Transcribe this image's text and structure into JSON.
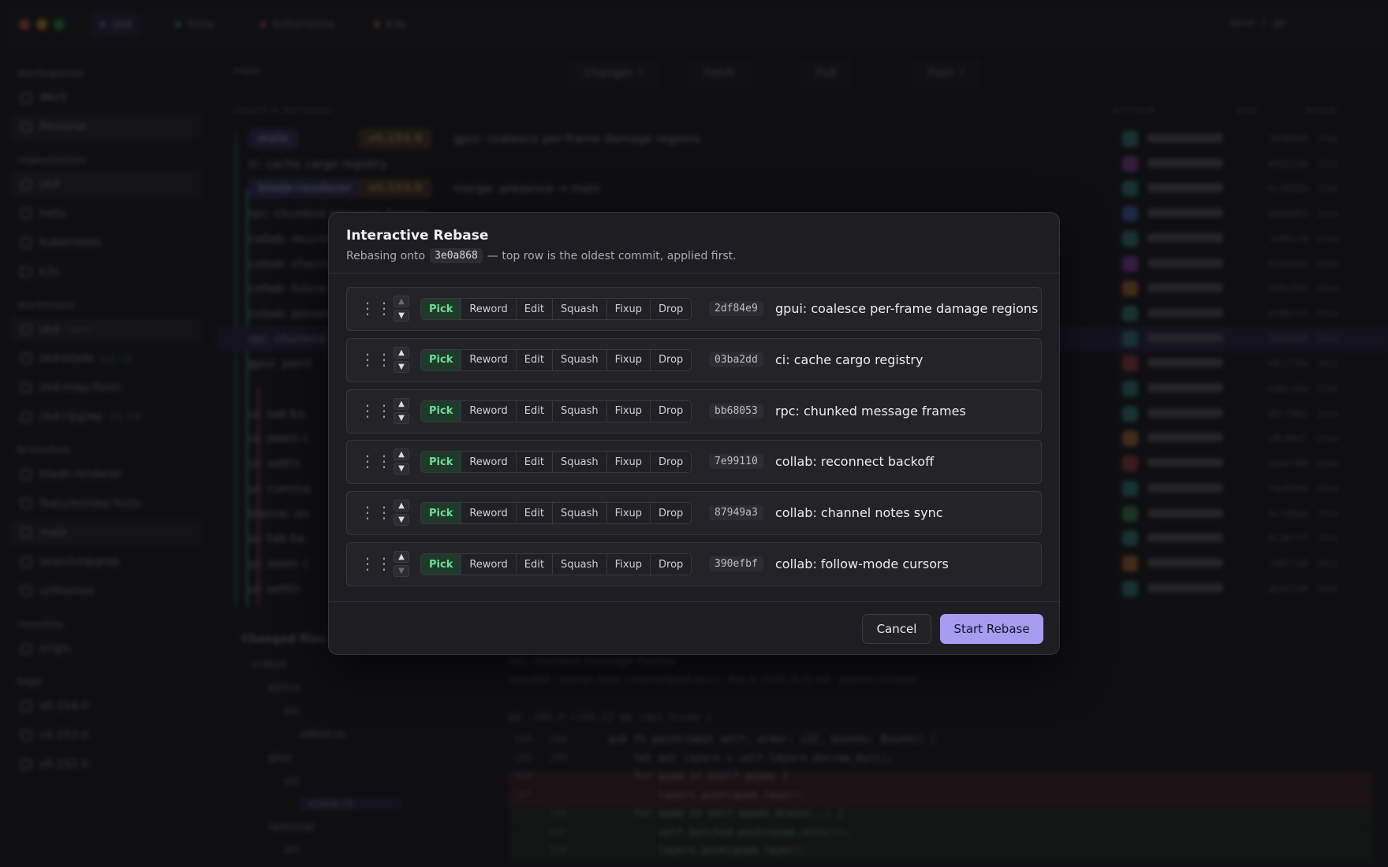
{
  "window": {
    "tabs": [
      {
        "label": "zed",
        "color": "#8b7cff"
      },
      {
        "label": "helix",
        "color": "#4cc47a"
      },
      {
        "label": "kubernetes",
        "color": "#e05a7a"
      },
      {
        "label": "k3s",
        "color": "#e0a040"
      }
    ],
    "branch_path": "main / go"
  },
  "sidebar": {
    "workspaces_heading": "workspaces",
    "workspaces": [
      "Work",
      "Personal"
    ],
    "repositories_heading": "repositories",
    "repositories": [
      "zed",
      "helix",
      "kubernetes",
      "k3s"
    ],
    "worktrees_heading": "worktrees",
    "worktrees": [
      {
        "label": "zed",
        "note": "(user)"
      },
      {
        "label": "zed-blade",
        "note": "+1 −2"
      },
      {
        "label": "zed-inlay-fonts",
        "note": ""
      },
      {
        "label": "zed-ripgrep",
        "note": "+1 ↑3"
      }
    ],
    "branches_heading": "branches",
    "branches": [
      "blade-renderer",
      "feature/inlay-fonts",
      "main",
      "search/ripgrep",
      "ui/themes"
    ],
    "remotes_heading": "remotes",
    "remotes": [
      "origin"
    ],
    "tags_heading": "tags",
    "tags": [
      "v0.154.0",
      "v0.153.0",
      "v0.152.0"
    ]
  },
  "main": {
    "breadcrumb": "main",
    "toolbar": {
      "changes": "Changes",
      "changes_count": "7",
      "fetch": "Fetch",
      "pull": "Pull",
      "push": "Push",
      "push_count": "7"
    },
    "columns": {
      "graph": "GRAPH & MESSAGE",
      "author": "AUTHOR",
      "sha": "SHA",
      "when": "WHEN"
    },
    "commits": [
      {
        "msg": "gpui: coalesce per-frame damage regions",
        "sha": "2df84e9",
        "when": "2mo",
        "avatar": "#3aa6a0",
        "pills": [
          "main",
          "v0.154.0"
        ]
      },
      {
        "msg": "ci: cache cargo registry",
        "sha": "03ba2dd",
        "when": "2mo",
        "avatar": "#b04ad0",
        "pills": []
      },
      {
        "msg": "merge: presence → main",
        "sha": "bc59d8a",
        "when": "2mo",
        "avatar": "#3aa6a0",
        "pills": [
          "blade-renderer",
          "v0.153.0"
        ]
      },
      {
        "msg": "rpc: chunked message frames",
        "sha": "bb68053",
        "when": "2mo",
        "avatar": "#4a7ae0",
        "pills": []
      },
      {
        "msg": "collab: reconnect backoff",
        "sha": "7e99110",
        "when": "2mo",
        "avatar": "#3aa6a0",
        "pills": []
      },
      {
        "msg": "collab: channel notes sync",
        "sha": "87949a3",
        "when": "2mo",
        "avatar": "#b04ad0",
        "pills": []
      },
      {
        "msg": "collab: follow-mode cursors",
        "sha": "390efbf",
        "when": "2mo",
        "avatar": "#e08a3a",
        "pills": []
      },
      {
        "msg": "collab: presence",
        "sha": "a3957f1",
        "when": "2mo",
        "avatar": "#3aa6a0",
        "pills": []
      },
      {
        "msg": "rpc: chunked",
        "sha": "3e0a868",
        "when": "2mo",
        "avatar": "#3aa6a0",
        "pills": []
      },
      {
        "msg": "gpui: point",
        "sha": "b812f5e",
        "when": "2mo",
        "avatar": "#d04848",
        "pills": []
      },
      {
        "msg": "",
        "sha": "eddc20a",
        "when": "2mo",
        "avatar": "#3aa6a0",
        "pills": []
      },
      {
        "msg": "ui: tab ba",
        "sha": "82cf962",
        "when": "2mo",
        "avatar": "#3aa6a0",
        "pills": []
      },
      {
        "msg": "ui: zoom c",
        "sha": "c8c86ef",
        "when": "2mo",
        "avatar": "#e08a3a",
        "pills": []
      },
      {
        "msg": "ui: settin",
        "sha": "1e4678d",
        "when": "2mo",
        "avatar": "#d04848",
        "pills": []
      },
      {
        "msg": "ui: comma",
        "sha": "7ac00ed",
        "when": "2mo",
        "avatar": "#3aa6a0",
        "pills": []
      },
      {
        "msg": "theme: on",
        "sha": "4c7d5ae",
        "when": "2mo",
        "avatar": "#4cb050",
        "pills": []
      },
      {
        "msg": "ui: tab ba",
        "sha": "4c3677f",
        "when": "2mo",
        "avatar": "#3aa6a0",
        "pills": []
      },
      {
        "msg": "ui: zoom c",
        "sha": "c4877a0",
        "when": "2mo",
        "avatar": "#e08a3a",
        "pills": []
      },
      {
        "msg": "ui: settin",
        "sha": "ab14fe8",
        "when": "2mo",
        "avatar": "#3aa6a0",
        "pills": []
      }
    ]
  },
  "bottom": {
    "changed_files": "Changed files",
    "tree": [
      "crates",
      "editor",
      "src",
      "editor.rs",
      "gpui",
      "src",
      "scene.rs",
      "terminal",
      "src"
    ],
    "commit_title": "rpc: chunked message frames",
    "commit_meta": "3e0a868 · Nathan Sobo <nathan@zed.dev> · Mar 9, 2026, 8:32 AM · parents a7b4aaf",
    "hunk": "@@ -184,9 +184,12 @@ impl Scene {",
    "diff": [
      {
        "kind": "ctx",
        "old": "184",
        "new": "184",
        "text": "    pub fn paint(&mut self, order: u32, bounds: Bounds) {"
      },
      {
        "kind": "ctx",
        "old": "185",
        "new": "185",
        "text": "        let mut layers = self.layers.borrow_mut();"
      },
      {
        "kind": "del",
        "old": "186",
        "new": "",
        "text": "        for quad in &self.quads {"
      },
      {
        "kind": "del",
        "old": "187",
        "new": "",
        "text": "            layers.push(quad.layer);"
      },
      {
        "kind": "add",
        "old": "",
        "new": "186",
        "text": "        for quad in self.quads.drain(..) {"
      },
      {
        "kind": "add",
        "old": "",
        "new": "187",
        "text": "            self.batched.push(quad.into());"
      },
      {
        "kind": "add",
        "old": "",
        "new": "188",
        "text": "            layers.push(quad.layer);"
      }
    ]
  },
  "modal": {
    "title": "Interactive Rebase",
    "subtitle_prefix": "Rebasing onto",
    "onto_sha": "3e0a868",
    "subtitle_suffix": "— top row is the oldest commit, applied first.",
    "actions": [
      "Pick",
      "Reword",
      "Edit",
      "Squash",
      "Fixup",
      "Drop"
    ],
    "rows": [
      {
        "action": "Pick",
        "sha": "2df84e9",
        "message": "gpui: coalesce per-frame damage regions"
      },
      {
        "action": "Pick",
        "sha": "03ba2dd",
        "message": "ci: cache cargo registry"
      },
      {
        "action": "Pick",
        "sha": "bb68053",
        "message": "rpc: chunked message frames"
      },
      {
        "action": "Pick",
        "sha": "7e99110",
        "message": "collab: reconnect backoff"
      },
      {
        "action": "Pick",
        "sha": "87949a3",
        "message": "collab: channel notes sync"
      },
      {
        "action": "Pick",
        "sha": "390efbf",
        "message": "collab: follow-mode cursors"
      }
    ],
    "cancel_label": "Cancel",
    "start_label": "Start Rebase",
    "accent": "#a79cf0",
    "pick_color": "#6fdc95"
  },
  "icons": {
    "drag": "⋮⋮",
    "up": "▲",
    "down": "▼"
  }
}
